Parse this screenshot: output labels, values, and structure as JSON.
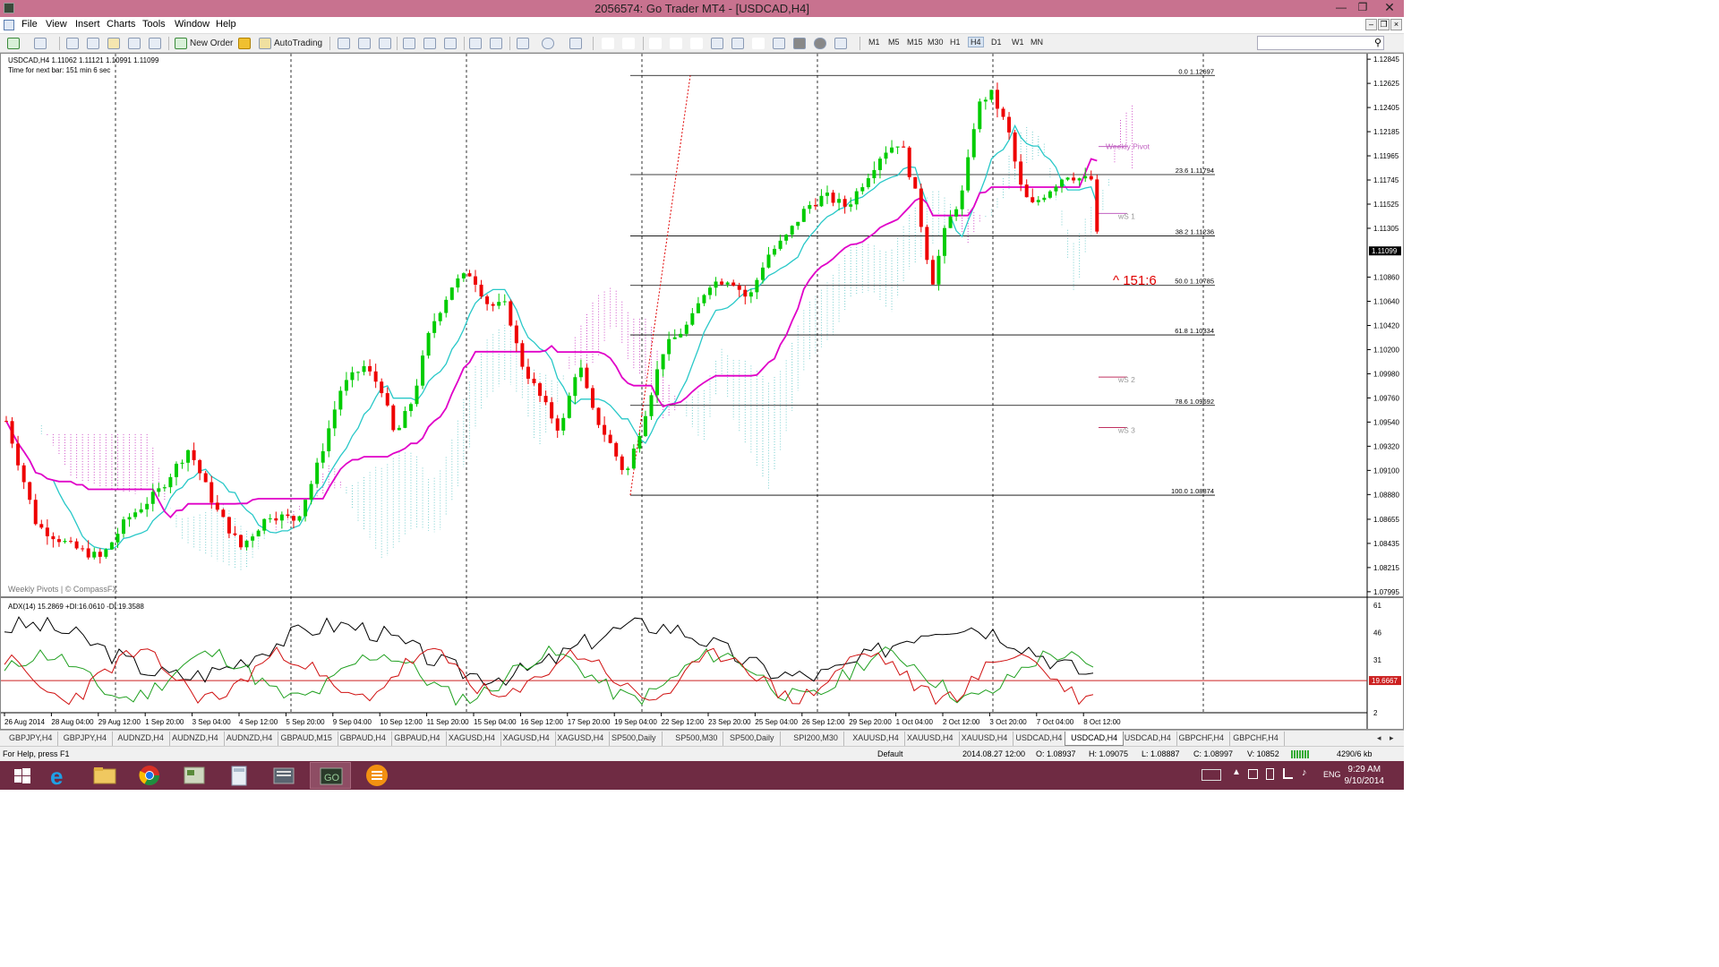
{
  "window": {
    "title": "2056574: Go Trader MT4 - [USDCAD,H4]"
  },
  "menu": [
    "File",
    "View",
    "Insert",
    "Charts",
    "Tools",
    "Window",
    "Help"
  ],
  "toolbar": {
    "new_order": "New Order",
    "autotrading": "AutoTrading",
    "timeframes": [
      "M1",
      "M5",
      "M15",
      "M30",
      "H1",
      "H4",
      "D1",
      "W1",
      "MN"
    ],
    "active_timeframe": "H4"
  },
  "chart": {
    "symbol_line": "USDCAD,H4  1.11062 1.11121 1.10991 1.11099",
    "next_bar": "Time for next bar: 151 min 6 sec",
    "watermark": "Weekly Pivots | © CompassFX",
    "price_labels": [
      "1.12845",
      "1.12625",
      "1.12405",
      "1.12185",
      "1.11965",
      "1.11745",
      "1.11525",
      "1.11305",
      "1.10860",
      "1.10640",
      "1.10420",
      "1.10200",
      "1.09980",
      "1.09760",
      "1.09540",
      "1.09320",
      "1.09100",
      "1.08880",
      "1.08655",
      "1.08435",
      "1.08215",
      "1.07995"
    ],
    "current_price": "1.11099",
    "fib_levels": [
      "0.0 1.12697",
      "23.6 1.11794",
      "38.2 1.11236",
      "50.0 1.10785",
      "61.8 1.10334",
      "78.6 1.09692",
      "100.0 1.08874"
    ],
    "pivot_labels": [
      "Weekly Pivot",
      "wS 1",
      "wS 2",
      "wS 3"
    ],
    "annotation": "151:6",
    "time_labels": [
      "26 Aug 2014",
      "28 Aug 04:00",
      "29 Aug 12:00",
      "1 Sep 20:00",
      "3 Sep 04:00",
      "4 Sep 12:00",
      "5 Sep 20:00",
      "9 Sep 04:00",
      "10 Sep 12:00",
      "11 Sep 20:00",
      "15 Sep 04:00",
      "16 Sep 12:00",
      "17 Sep 20:00",
      "19 Sep 04:00",
      "22 Sep 12:00",
      "23 Sep 20:00",
      "25 Sep 04:00",
      "26 Sep 12:00",
      "29 Sep 20:00",
      "1 Oct 04:00",
      "2 Oct 12:00",
      "3 Oct 20:00",
      "7 Oct 04:00",
      "8 Oct 12:00"
    ],
    "adx_label": "ADX(14) 15.2869 +DI:16.0610 -DI:19.3588",
    "adx_scale": [
      "61",
      "46",
      "31",
      "19.6667",
      "2"
    ],
    "colors": {
      "bull": "#00cc00",
      "bear": "#ee0000",
      "kijun": "#e000c8",
      "tenkan": "#28c8c8",
      "adx": "#000000"
    }
  },
  "tabs": [
    "GBPJPY,H4",
    "GBPJPY,H4",
    "AUDNZD,H4",
    "AUDNZD,H4",
    "AUDNZD,H4",
    "GBPAUD,M15",
    "GBPAUD,H4",
    "GBPAUD,H4",
    "XAGUSD,H4",
    "XAGUSD,H4",
    "XAGUSD,H4",
    "SP500,Daily",
    "SP500,M30",
    "SP500,Daily",
    "SPI200,M30",
    "XAUUSD,H4",
    "XAUUSD,H4",
    "XAUUSD,H4",
    "USDCAD,H4",
    "USDCAD,H4",
    "USDCAD,H4",
    "GBPCHF,H4",
    "GBPCHF,H4"
  ],
  "active_tab": "USDCAD,H4",
  "status": {
    "help": "For Help, press F1",
    "profile": "Default",
    "time": "2014.08.27 12:00",
    "open": "O: 1.08937",
    "high": "H: 1.09075",
    "low": "L: 1.08887",
    "close": "C: 1.08997",
    "volume": "V: 10852",
    "traffic": "4290/6 kb"
  },
  "taskbar": {
    "lang": "ENG",
    "time": "9:29 AM",
    "date": "9/10/2014"
  }
}
